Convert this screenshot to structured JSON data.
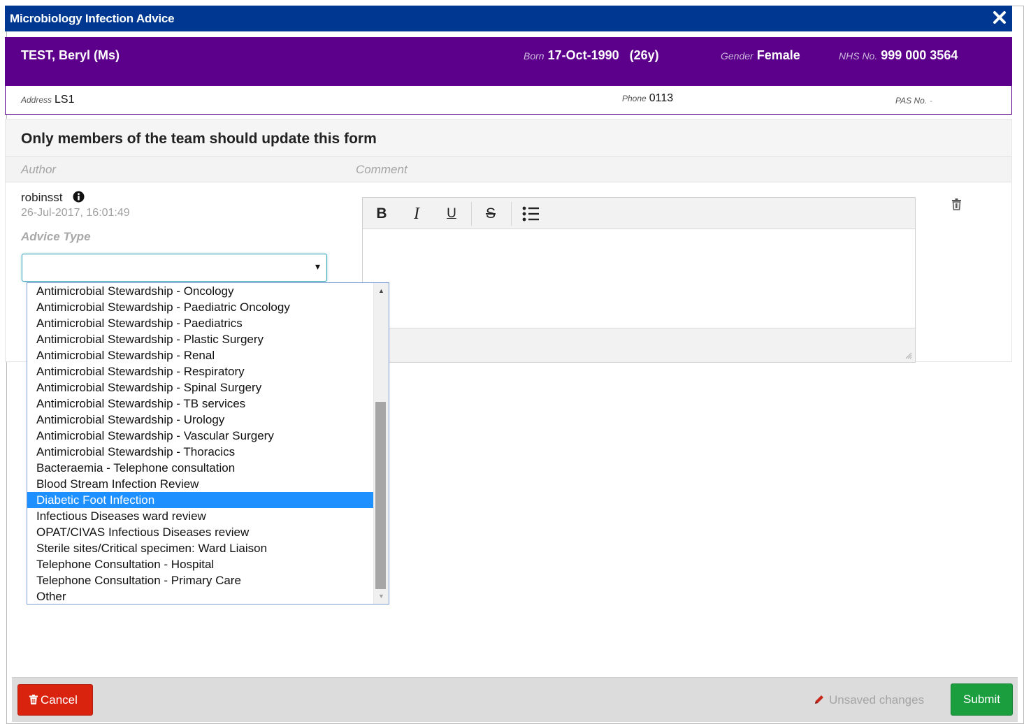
{
  "dialog": {
    "title": "Microbiology Infection Advice",
    "close_icon": "close-icon"
  },
  "patient": {
    "name": "TEST, Beryl (Ms)",
    "born_label": "Born",
    "born_value": "17-Oct-1990   (26y)",
    "gender_label": "Gender",
    "gender_value": "Female",
    "nhs_label": "NHS No.",
    "nhs_value": "999 000 3564",
    "address_label": "Address",
    "address_value": "LS1",
    "phone_label": "Phone",
    "phone_value": "0113",
    "pas_label": "PAS No.",
    "pas_value": "-"
  },
  "form": {
    "warning": "Only members of the team should update this form",
    "author_header": "Author",
    "comment_header": "Comment",
    "entry": {
      "user": "robinsst",
      "timestamp": "26-Jul-2017, 16:01:49",
      "advice_type_label": "Advice Type",
      "advice_type_value": "",
      "select_arrow": "▾"
    }
  },
  "dropdown": {
    "selected_index": 13,
    "options": [
      "Antimicrobial Stewardship - Oncology",
      "Antimicrobial Stewardship - Paediatric Oncology",
      "Antimicrobial Stewardship - Paediatrics",
      "Antimicrobial Stewardship - Plastic Surgery",
      "Antimicrobial Stewardship - Renal",
      "Antimicrobial Stewardship - Respiratory",
      "Antimicrobial Stewardship - Spinal Surgery",
      "Antimicrobial Stewardship - TB services",
      "Antimicrobial Stewardship - Urology",
      "Antimicrobial Stewardship - Vascular Surgery",
      "Antimicrobial Stewardship - Thoracics",
      "Bacteraemia - Telephone consultation",
      "Blood Stream Infection Review",
      "Diabetic Foot Infection",
      "Infectious Diseases ward review",
      "OPAT/CIVAS Infectious Diseases review",
      "Sterile sites/Critical specimen: Ward Liaison",
      "Telephone Consultation - Hospital",
      "Telephone Consultation - Primary Care",
      "Other"
    ]
  },
  "editor": {
    "bold_label": "B",
    "italic_label": "I",
    "underline_label": "U",
    "strike_label": "S",
    "content": ""
  },
  "footer": {
    "cancel_label": "Cancel",
    "unsaved_label": "Unsaved changes",
    "submit_label": "Submit"
  },
  "colors": {
    "title_bar": "#003891",
    "patient_banner": "#5c008c",
    "selected_option": "#1e90ff",
    "cancel": "#d9230f",
    "submit": "#1a9e3e"
  }
}
